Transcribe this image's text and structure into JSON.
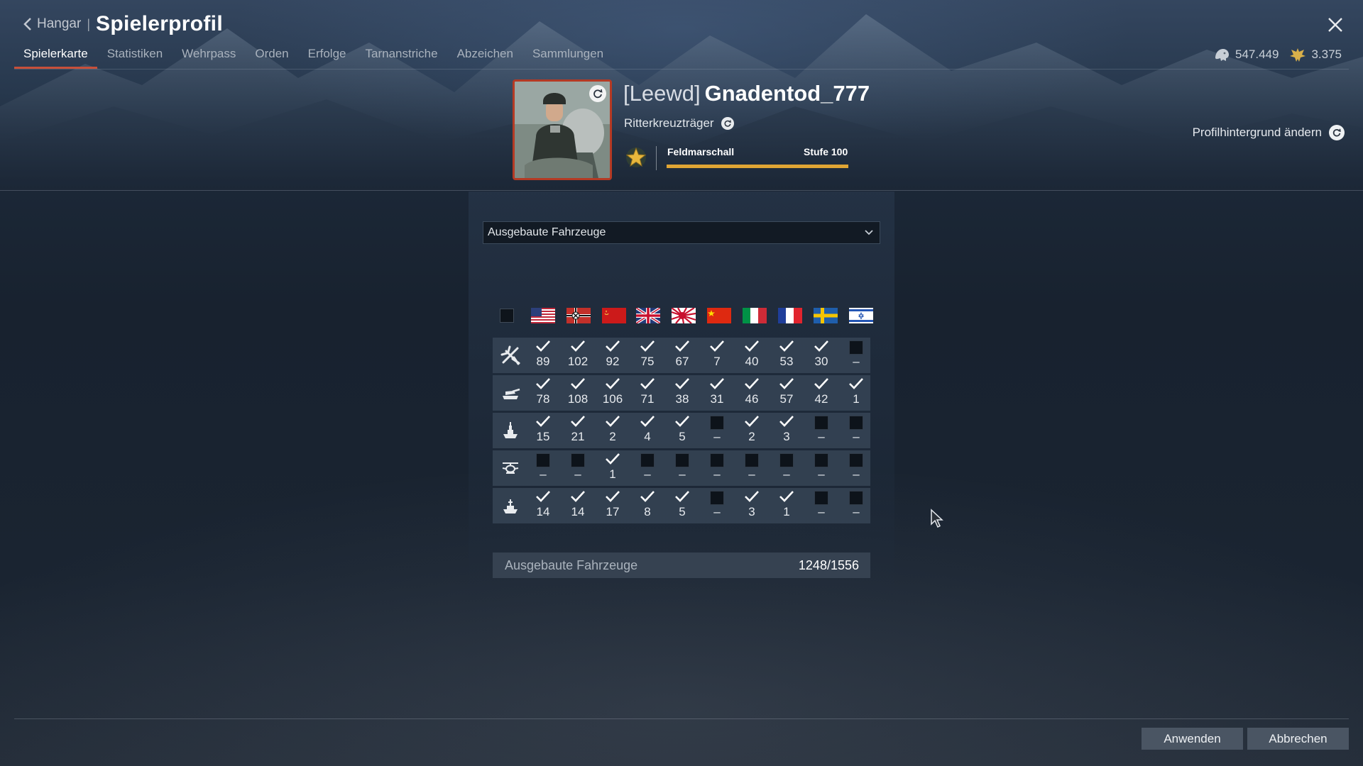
{
  "header": {
    "back_label": "Hangar",
    "separator": "|",
    "title": "Spielerprofil"
  },
  "tabs": [
    {
      "label": "Spielerkarte",
      "active": true
    },
    {
      "label": "Statistiken"
    },
    {
      "label": "Wehrpass"
    },
    {
      "label": "Orden"
    },
    {
      "label": "Erfolge"
    },
    {
      "label": "Tarnanstriche"
    },
    {
      "label": "Abzeichen"
    },
    {
      "label": "Sammlungen"
    }
  ],
  "currency": {
    "silver_lions": "547.449",
    "golden_eagles": "3.375"
  },
  "profile": {
    "clan_tag": "[Leewd]",
    "nickname": "Gnadentod_777",
    "title": "Ritterkreuzträger",
    "rank_name": "Feldmarschall",
    "rank_level": "Stufe 100",
    "rank_progress": 1.0
  },
  "background_change_label": "Profilhintergrund ändern",
  "dropdown": {
    "selected": "Ausgebaute Fahrzeuge"
  },
  "nations": [
    "usa",
    "germany",
    "ussr",
    "britain",
    "japan",
    "china",
    "italy",
    "france",
    "sweden",
    "israel"
  ],
  "vehicle_types": [
    "aircraft-icon",
    "tank-icon",
    "fleet-icon",
    "helicopter-icon",
    "coastal-fleet-icon"
  ],
  "grid": [
    [
      {
        "c": true,
        "v": "89"
      },
      {
        "c": true,
        "v": "102"
      },
      {
        "c": true,
        "v": "92"
      },
      {
        "c": true,
        "v": "75"
      },
      {
        "c": true,
        "v": "67"
      },
      {
        "c": true,
        "v": "7"
      },
      {
        "c": true,
        "v": "40"
      },
      {
        "c": true,
        "v": "53"
      },
      {
        "c": true,
        "v": "30"
      },
      {
        "c": false,
        "v": "–"
      }
    ],
    [
      {
        "c": true,
        "v": "78"
      },
      {
        "c": true,
        "v": "108"
      },
      {
        "c": true,
        "v": "106"
      },
      {
        "c": true,
        "v": "71"
      },
      {
        "c": true,
        "v": "38"
      },
      {
        "c": true,
        "v": "31"
      },
      {
        "c": true,
        "v": "46"
      },
      {
        "c": true,
        "v": "57"
      },
      {
        "c": true,
        "v": "42"
      },
      {
        "c": true,
        "v": "1"
      }
    ],
    [
      {
        "c": true,
        "v": "15"
      },
      {
        "c": true,
        "v": "21"
      },
      {
        "c": true,
        "v": "2"
      },
      {
        "c": true,
        "v": "4"
      },
      {
        "c": true,
        "v": "5"
      },
      {
        "c": false,
        "v": "–"
      },
      {
        "c": true,
        "v": "2"
      },
      {
        "c": true,
        "v": "3"
      },
      {
        "c": false,
        "v": "–"
      },
      {
        "c": false,
        "v": "–"
      }
    ],
    [
      {
        "c": false,
        "v": "–"
      },
      {
        "c": false,
        "v": "–"
      },
      {
        "c": true,
        "v": "1"
      },
      {
        "c": false,
        "v": "–"
      },
      {
        "c": false,
        "v": "–"
      },
      {
        "c": false,
        "v": "–"
      },
      {
        "c": false,
        "v": "–"
      },
      {
        "c": false,
        "v": "–"
      },
      {
        "c": false,
        "v": "–"
      },
      {
        "c": false,
        "v": "–"
      }
    ],
    [
      {
        "c": true,
        "v": "14"
      },
      {
        "c": true,
        "v": "14"
      },
      {
        "c": true,
        "v": "17"
      },
      {
        "c": true,
        "v": "8"
      },
      {
        "c": true,
        "v": "5"
      },
      {
        "c": false,
        "v": "–"
      },
      {
        "c": true,
        "v": "3"
      },
      {
        "c": true,
        "v": "1"
      },
      {
        "c": false,
        "v": "–"
      },
      {
        "c": false,
        "v": "–"
      }
    ]
  ],
  "total": {
    "label": "Ausgebaute Fahrzeuge",
    "value": "1248/1556"
  },
  "buttons": {
    "apply": "Anwenden",
    "cancel": "Abbrechen"
  },
  "colors": {
    "accent": "#c74f3a",
    "rank_bar": "#e0a534",
    "button": "#4a5563"
  }
}
